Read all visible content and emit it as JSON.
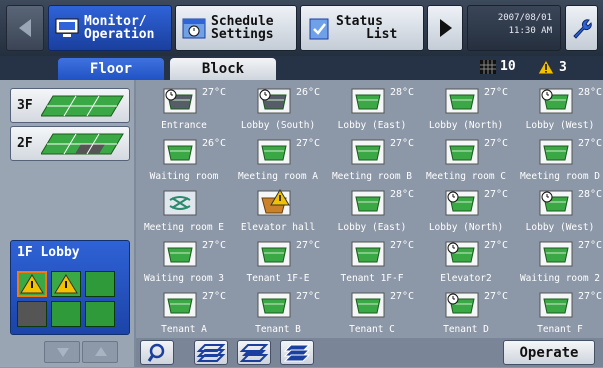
{
  "header": {
    "monitor": [
      "Monitor/",
      "Operation"
    ],
    "schedule": [
      "Schedule",
      "Settings"
    ],
    "status": [
      "Status",
      "List"
    ],
    "date": "2007/08/01",
    "time": "11:30 AM"
  },
  "tabs": {
    "floor": "Floor",
    "block": "Block"
  },
  "counts": {
    "units": "10",
    "warnings": "3"
  },
  "floors": [
    {
      "label": "3F"
    },
    {
      "label": "2F"
    },
    {
      "label": "1F Lobby"
    }
  ],
  "units": [
    {
      "name": "Entrance",
      "temp": "27°C",
      "icon": "timer-unit",
      "color": "dark"
    },
    {
      "name": "Lobby (South)",
      "temp": "26°C",
      "icon": "timer-unit",
      "color": "dark"
    },
    {
      "name": "Lobby (East)",
      "temp": "28°C",
      "icon": "ac-unit",
      "color": "green"
    },
    {
      "name": "Lobby (North)",
      "temp": "27°C",
      "icon": "ac-unit",
      "color": "green"
    },
    {
      "name": "Lobby (West)",
      "temp": "28°C",
      "icon": "timer-unit",
      "color": "green"
    },
    {
      "name": "Waiting room",
      "temp": "26°C",
      "icon": "ac-unit",
      "color": "green"
    },
    {
      "name": "Meeting room A",
      "temp": "27°C",
      "icon": "ac-unit",
      "color": "green"
    },
    {
      "name": "Meeting room B",
      "temp": "27°C",
      "icon": "ac-unit",
      "color": "green"
    },
    {
      "name": "Meeting room C",
      "temp": "27°C",
      "icon": "ac-unit",
      "color": "green"
    },
    {
      "name": "Meeting room D",
      "temp": "27°C",
      "icon": "ac-unit",
      "color": "green"
    },
    {
      "name": "Meeting room E",
      "temp": "",
      "icon": "fan-unit",
      "color": "light"
    },
    {
      "name": "Elevator hall",
      "temp": "",
      "icon": "warning-unit",
      "color": "orange"
    },
    {
      "name": "Lobby (East)",
      "temp": "28°C",
      "icon": "ac-unit",
      "color": "green"
    },
    {
      "name": "Lobby (North)",
      "temp": "27°C",
      "icon": "timer-unit",
      "color": "green"
    },
    {
      "name": "Lobby (West)",
      "temp": "28°C",
      "icon": "timer-unit",
      "color": "green"
    },
    {
      "name": "Waiting room 3",
      "temp": "27°C",
      "icon": "ac-unit",
      "color": "green"
    },
    {
      "name": "Tenant 1F-E",
      "temp": "27°C",
      "icon": "ac-unit",
      "color": "green"
    },
    {
      "name": "Tenant 1F-F",
      "temp": "27°C",
      "icon": "ac-unit",
      "color": "green"
    },
    {
      "name": "Elevator2",
      "temp": "27°C",
      "icon": "timer-unit",
      "color": "green"
    },
    {
      "name": "Waiting room 2",
      "temp": "27°C",
      "icon": "ac-unit",
      "color": "green"
    },
    {
      "name": "Tenant A",
      "temp": "27°C",
      "icon": "ac-unit",
      "color": "green"
    },
    {
      "name": "Tenant B",
      "temp": "27°C",
      "icon": "ac-unit",
      "color": "green"
    },
    {
      "name": "Tenant C",
      "temp": "27°C",
      "icon": "ac-unit",
      "color": "green"
    },
    {
      "name": "Tenant D",
      "temp": "27°C",
      "icon": "timer-unit",
      "color": "green"
    },
    {
      "name": "Tenant F",
      "temp": "27°C",
      "icon": "ac-unit",
      "color": "green"
    }
  ],
  "footer": {
    "operate": "Operate"
  },
  "colors": {
    "accent": "#2152c4",
    "unit_green": "#2f9a3a",
    "warning": "#f2c200"
  }
}
